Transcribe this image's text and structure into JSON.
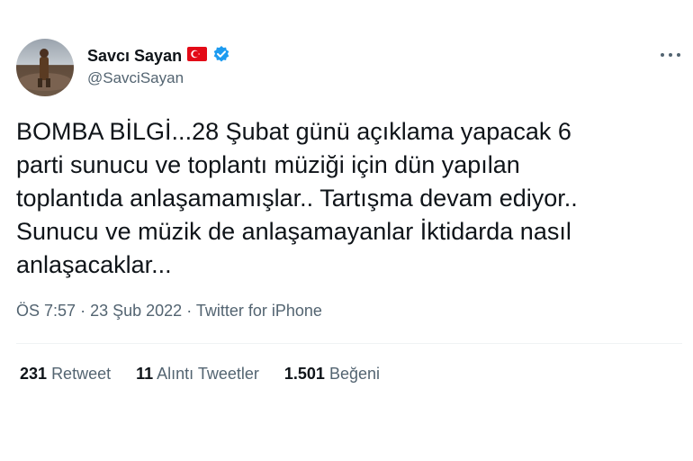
{
  "user": {
    "display_name": "Savcı Sayan",
    "handle": "@SavciSayan"
  },
  "tweet": {
    "text": "BOMBA BİLGİ...28 Şubat günü açıklama yapacak 6\nparti sunucu ve toplantı müziği için dün yapılan\ntoplantıda anlaşamamışlar.. Tartışma devam ediyor..\nSunucu ve müzik de anlaşamayanlar İktidarda nasıl\nanlaşacaklar...",
    "time": "ÖS 7:57",
    "date": "23 Şub 2022",
    "source": "Twitter for iPhone",
    "separator": "·"
  },
  "stats": {
    "retweets": {
      "count": "231",
      "label": "Retweet"
    },
    "quotes": {
      "count": "11",
      "label": "Alıntı Tweetler"
    },
    "likes": {
      "count": "1.501",
      "label": "Beğeni"
    }
  },
  "colors": {
    "verified": "#1d9bf0",
    "flag_red": "#e30a17",
    "secondary_text": "#536471"
  },
  "icons": [
    "turkey-flag-icon",
    "verified-badge-icon",
    "more-options-icon"
  ]
}
